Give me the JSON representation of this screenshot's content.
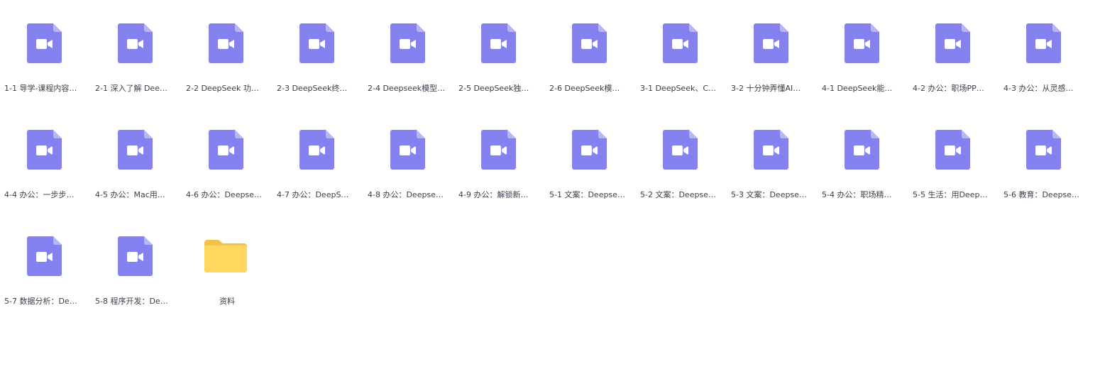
{
  "colors": {
    "video_body": "#8481f0",
    "video_fold": "#b8b6f7",
    "video_glyph": "#ffffff",
    "folder_back": "#f2c04c",
    "folder_front": "#ffd75e",
    "label_text": "#3a3f4a"
  },
  "files": [
    {
      "label": "1-1 导学-课程内容…",
      "icon": "video-file-icon",
      "kind": "video"
    },
    {
      "label": "2-1 深入了解 Dee…",
      "icon": "video-file-icon",
      "kind": "video"
    },
    {
      "label": "2-2 DeepSeek 功…",
      "icon": "video-file-icon",
      "kind": "video"
    },
    {
      "label": "2-3 DeepSeek终…",
      "icon": "video-file-icon",
      "kind": "video"
    },
    {
      "label": "2-4 Deepseek模型…",
      "icon": "video-file-icon",
      "kind": "video"
    },
    {
      "label": "2-5 DeepSeek独…",
      "icon": "video-file-icon",
      "kind": "video"
    },
    {
      "label": "2-6 DeepSeek模…",
      "icon": "video-file-icon",
      "kind": "video"
    },
    {
      "label": "3-1 DeepSeek、C…",
      "icon": "video-file-icon",
      "kind": "video"
    },
    {
      "label": "3-2 十分钟弄懂AI…",
      "icon": "video-file-icon",
      "kind": "video"
    },
    {
      "label": "4-1 DeepSeek能…",
      "icon": "video-file-icon",
      "kind": "video"
    },
    {
      "label": "4-2 办公：职场PP…",
      "icon": "video-file-icon",
      "kind": "video"
    },
    {
      "label": "4-3 办公：从灵感…",
      "icon": "video-file-icon",
      "kind": "video"
    },
    {
      "label": "4-4 办公：一步步…",
      "icon": "video-file-icon",
      "kind": "video"
    },
    {
      "label": "4-5 办公：Mac用…",
      "icon": "video-file-icon",
      "kind": "video"
    },
    {
      "label": "4-6 办公：Deepse…",
      "icon": "video-file-icon",
      "kind": "video"
    },
    {
      "label": "4-7 办公：DeepS…",
      "icon": "video-file-icon",
      "kind": "video"
    },
    {
      "label": "4-8 办公：Deepse…",
      "icon": "video-file-icon",
      "kind": "video"
    },
    {
      "label": "4-9 办公：解锁新…",
      "icon": "video-file-icon",
      "kind": "video"
    },
    {
      "label": "5-1 文案：Deepse…",
      "icon": "video-file-icon",
      "kind": "video"
    },
    {
      "label": "5-2 文案：Deepse…",
      "icon": "video-file-icon",
      "kind": "video"
    },
    {
      "label": "5-3 文案：Deepse…",
      "icon": "video-file-icon",
      "kind": "video"
    },
    {
      "label": "5-4 办公：职场精…",
      "icon": "video-file-icon",
      "kind": "video"
    },
    {
      "label": "5-5 生活：用Deep…",
      "icon": "video-file-icon",
      "kind": "video"
    },
    {
      "label": "5-6 教育：Deepse…",
      "icon": "video-file-icon",
      "kind": "video"
    },
    {
      "label": "5-7 数据分析：De…",
      "icon": "video-file-icon",
      "kind": "video"
    },
    {
      "label": "5-8 程序开发：De…",
      "icon": "video-file-icon",
      "kind": "video"
    },
    {
      "label": "资料",
      "icon": "folder-icon",
      "kind": "folder"
    }
  ]
}
